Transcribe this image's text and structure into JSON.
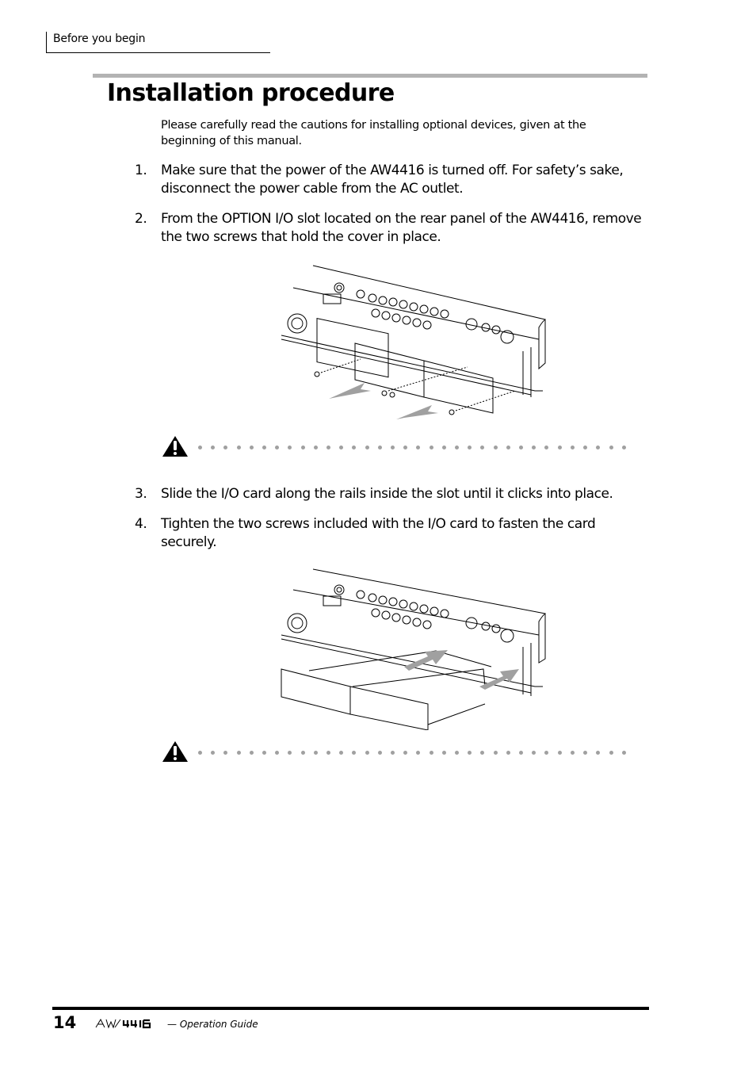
{
  "header": {
    "section": "Before you begin"
  },
  "page": {
    "title": "Installation procedure",
    "intro": "Please carefully read the cautions for installing optional devices, given at the beginning of this manual.",
    "steps": [
      {
        "num": "1.",
        "text": "Make sure that the power of the AW4416 is turned off. For safety’s sake, disconnect the power cable from the AC outlet."
      },
      {
        "num": "2.",
        "text": "From the OPTION I/O slot located on the rear panel of the AW4416, remove the two screws that hold the cover in place."
      },
      {
        "num": "3.",
        "text": "Slide the I/O card along the rails inside the slot until it clicks into place."
      },
      {
        "num": "4.",
        "text": "Tighten the two screws included with the I/O card to fasten the card securely."
      }
    ],
    "figures": [
      {
        "name": "remove-slot-cover-illustration",
        "icon": "rear-panel-cover-removal-drawing"
      },
      {
        "name": "insert-io-card-illustration",
        "icon": "rear-panel-card-insertion-drawing"
      }
    ],
    "cautions": [
      {
        "icon": "warning-triangle-icon",
        "dot_count": 34
      },
      {
        "icon": "warning-triangle-icon",
        "dot_count": 34
      }
    ]
  },
  "footer": {
    "page_number": "14",
    "product_logo": "AW4416",
    "guide_label": "— Operation Guide"
  }
}
